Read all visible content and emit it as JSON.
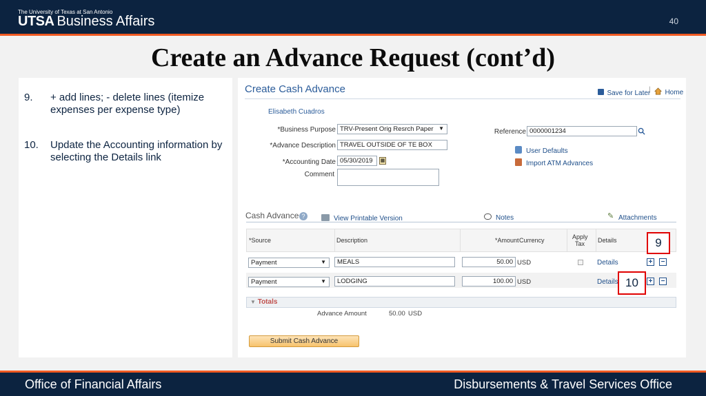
{
  "header": {
    "university_line": "The University of Texas at San Antonio",
    "brand_bold": "UTSA",
    "brand_text": "Business Affairs",
    "page_number": "40"
  },
  "slide": {
    "title": "Create an Advance Request (cont’d)",
    "steps": [
      {
        "num": "9.",
        "text": "+ add lines; - delete lines (itemize expenses per expense type)"
      },
      {
        "num": "10.",
        "text": "Update the Accounting information by selecting the Details link"
      }
    ]
  },
  "screen": {
    "page_title": "Create Cash Advance",
    "save_for_later": "Save for Later",
    "home": "Home",
    "employee_name": "Elisabeth Cuadros",
    "business_purpose_label": "*Business Purpose",
    "business_purpose_value": "TRV-Present Orig Resrch Paper",
    "advance_description_label": "*Advance Description",
    "advance_description_value": "TRAVEL OUTSIDE OF TE BOX",
    "accounting_date_label": "*Accounting Date",
    "accounting_date_value": "05/30/2019",
    "comment_label": "Comment",
    "comment_value": "",
    "reference_label": "Reference",
    "reference_value": "0000001234",
    "user_defaults": "User Defaults",
    "import_atm": "Import ATM Advances",
    "section_title": "Cash Advance",
    "view_printable": "View Printable Version",
    "notes": "Notes",
    "attachments": "Attachments",
    "columns": {
      "source": "*Source",
      "description": "Description",
      "amount": "*Amount",
      "currency": "Currency",
      "apply_tax_1": "Apply",
      "apply_tax_2": "Tax",
      "details": "Details"
    },
    "rows": [
      {
        "source": "Payment",
        "description": "MEALS",
        "amount": "50.00",
        "currency": "USD",
        "details": "Details"
      },
      {
        "source": "Payment",
        "description": "LODGING",
        "amount": "100.00",
        "currency": "USD",
        "details": "Details"
      }
    ],
    "totals_label": "Totals",
    "advance_amount_label": "Advance Amount",
    "advance_amount_value": "50.00",
    "advance_amount_currency": "USD",
    "submit_button": "Submit Cash Advance",
    "callout_9": "9",
    "callout_10": "10"
  },
  "footer": {
    "left": "Office of Financial Affairs",
    "right": "Disbursements & Travel Services Office"
  },
  "colors": {
    "navy": "#0c2340",
    "orange": "#f15a22",
    "link_blue": "#1f4f8a",
    "callout_red": "#e00000"
  }
}
